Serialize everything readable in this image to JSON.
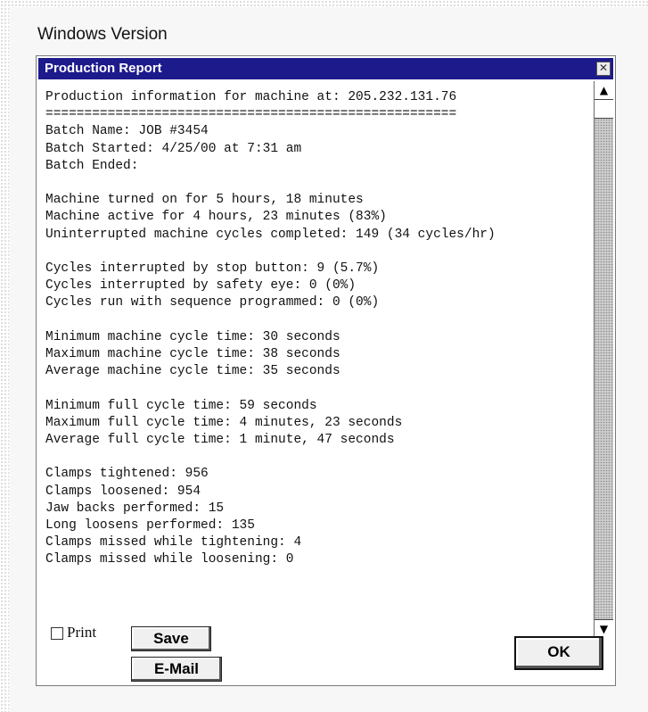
{
  "caption": "Windows Version",
  "window": {
    "title": "Production Report",
    "close_symbol": "✕"
  },
  "report_lines": [
    "Production information for machine at: 205.232.131.76",
    "=====================================================",
    "Batch Name: JOB #3454",
    "Batch Started: 4/25/00 at 7:31 am",
    "Batch Ended:",
    "",
    "Machine turned on for 5 hours, 18 minutes",
    "Machine active for 4 hours, 23 minutes (83%)",
    "Uninterrupted machine cycles completed: 149 (34 cycles/hr)",
    "",
    "Cycles interrupted by stop button: 9 (5.7%)",
    "Cycles interrupted by safety eye: 0 (0%)",
    "Cycles run with sequence programmed: 0 (0%)",
    "",
    "Minimum machine cycle time: 30 seconds",
    "Maximum machine cycle time: 38 seconds",
    "Average machine cycle time: 35 seconds",
    "",
    "Minimum full cycle time: 59 seconds",
    "Maximum full cycle time: 4 minutes, 23 seconds",
    "Average full cycle time: 1 minute, 47 seconds",
    "",
    "Clamps tightened: 956",
    "Clamps loosened: 954",
    "Jaw backs performed: 15",
    "Long loosens performed: 135",
    "Clamps missed while tightening: 4",
    "Clamps missed while loosening: 0"
  ],
  "scrollbar": {
    "up_symbol": "▲",
    "down_symbol": "▼"
  },
  "controls": {
    "print_label": "Print",
    "print_checked": false,
    "save_label": "Save",
    "email_label": "E-Mail",
    "ok_label": "OK"
  },
  "colors": {
    "titlebar": "#1d1a8c",
    "titlebar_text": "#ffffff"
  }
}
